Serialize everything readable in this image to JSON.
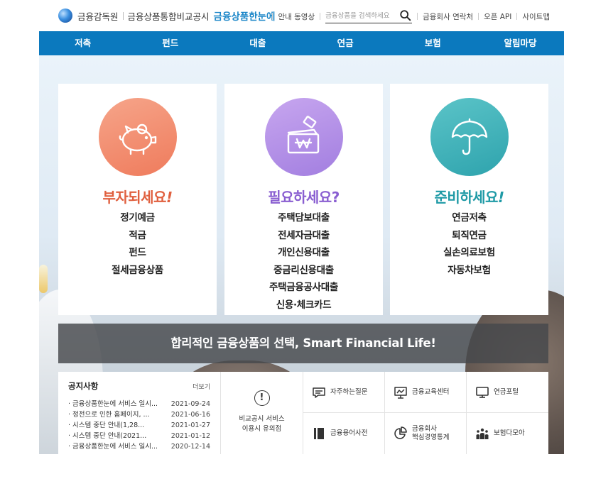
{
  "header": {
    "logo_org": "금융감독원",
    "logo_service": "금융상품통합비교공시",
    "logo_brand": "금융상품한눈에",
    "util": {
      "guide_video": "안내 동영상",
      "search_placeholder": "금융상품을 검색하세요",
      "contact": "금융회사 연락처",
      "open_api": "오픈 API",
      "sitemap": "사이트맵"
    }
  },
  "nav": [
    {
      "label": "저축"
    },
    {
      "label": "펀드"
    },
    {
      "label": "대출"
    },
    {
      "label": "연금"
    },
    {
      "label": "보험"
    },
    {
      "label": "알림마당"
    }
  ],
  "cards": [
    {
      "title": "부자되세요",
      "mark": "!",
      "icon": "piggy-bank-icon",
      "color": "#e0603f",
      "items": [
        "정기예금",
        "적금",
        "펀드",
        "절세금융상품"
      ]
    },
    {
      "title": "필요하세요",
      "mark": "?",
      "icon": "wallet-won-icon",
      "color": "#8a5fd1",
      "items": [
        "주택담보대출",
        "전세자금대출",
        "개인신용대출",
        "중금리신용대출",
        "주택금융공사대출",
        "신용·체크카드"
      ]
    },
    {
      "title": "준비하세요",
      "mark": "!",
      "icon": "umbrella-icon",
      "color": "#1f9aa6",
      "items": [
        "연금저축",
        "퇴직연금",
        "실손의료보험",
        "자동차보험"
      ]
    }
  ],
  "banner": {
    "text": "합리적인 금융상품의 선택, Smart Financial Life!"
  },
  "notice": {
    "title": "공지사항",
    "more": "더보기",
    "items": [
      {
        "text": "금융상품한눈에 서비스 일시...",
        "date": "2021-09-24"
      },
      {
        "text": "정전으로 인한 홈페이지, ...",
        "date": "2021-06-16"
      },
      {
        "text": "시스템 중단 안내(1,28...",
        "date": "2021-01-27"
      },
      {
        "text": "시스템 중단 안내(2021...",
        "date": "2021-01-12"
      },
      {
        "text": "금융상품한눈에 서비스 일시...",
        "date": "2020-12-14"
      }
    ]
  },
  "caution": {
    "line1": "비교공시 서비스",
    "line2": "이용시 유의점"
  },
  "quick_links": [
    {
      "label": "자주하는질문",
      "icon": "chat-bubble-icon"
    },
    {
      "label": "금융교육센터",
      "icon": "presentation-board-icon"
    },
    {
      "label": "연금포털",
      "icon": "monitor-icon"
    },
    {
      "label": "금융용어사전",
      "icon": "book-icon"
    },
    {
      "label": "금융회사\n핵심경영통계",
      "icon": "pie-chart-icon"
    },
    {
      "label": "보험다모아",
      "icon": "people-group-icon"
    }
  ]
}
